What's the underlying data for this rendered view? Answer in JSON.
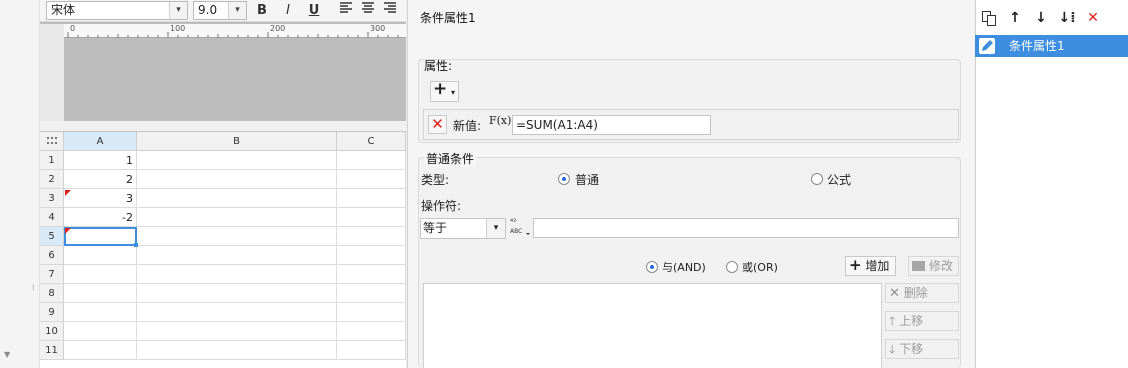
{
  "toolbar": {
    "font_name": "宋体",
    "font_size": "9.0",
    "bold": "B",
    "italic": "I",
    "underline": "U"
  },
  "ruler": {
    "ticks": [
      "0",
      "100",
      "200",
      "300"
    ]
  },
  "grid": {
    "corner_icon": "grid-menu-icon",
    "columns": [
      "A",
      "B",
      "C"
    ],
    "rows": [
      {
        "num": "1",
        "a": "1"
      },
      {
        "num": "2",
        "a": "2"
      },
      {
        "num": "3",
        "a": "3"
      },
      {
        "num": "4",
        "a": "-2"
      },
      {
        "num": "5",
        "a": ""
      },
      {
        "num": "6",
        "a": ""
      },
      {
        "num": "7",
        "a": ""
      },
      {
        "num": "8",
        "a": ""
      },
      {
        "num": "9",
        "a": ""
      },
      {
        "num": "10",
        "a": ""
      },
      {
        "num": "11",
        "a": ""
      }
    ]
  },
  "dialog": {
    "title": "条件属性1",
    "attr_section": "属性:",
    "new_value_label": "新值:",
    "formula_icon_text": "F(x)",
    "new_value": "=SUM(A1:A4)",
    "condition_section": "普通条件",
    "type_label": "类型:",
    "type_normal": "普通",
    "type_formula": "公式",
    "operator_label": "操作符:",
    "operator_value": "等于",
    "operand_value": "",
    "and_label": "与(AND)",
    "or_label": "或(OR)",
    "add_button": "增加",
    "modify_button": "修改",
    "delete_button": "删除",
    "move_up_button": "上移",
    "move_down_button": "下移"
  },
  "right_panel": {
    "items": [
      "条件属性1"
    ]
  },
  "colors": {
    "selection_blue": "#3d8ee0",
    "delete_red": "#e0211b",
    "radio_blue": "#2a6dd6"
  }
}
